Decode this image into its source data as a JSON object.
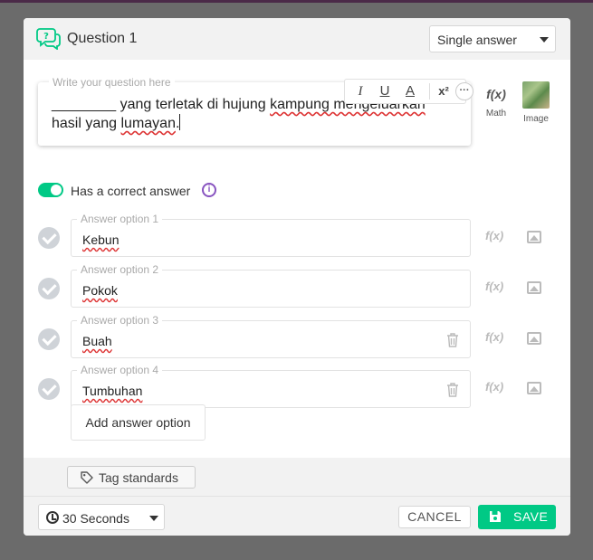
{
  "header": {
    "title": "Question 1",
    "question_type": "Single answer"
  },
  "question": {
    "placeholder_label": "Write your question here",
    "text_blank": "________",
    "text_1": " yang terletak di hujung ",
    "text_2": "kampung mengeluarkan",
    "text_3": "hasil yang ",
    "text_4": "lumayan",
    "text_5": "."
  },
  "toolbar": {
    "italic": "I",
    "underline": "U",
    "color": "A",
    "superscript": "x²",
    "more": "···"
  },
  "side_tools": {
    "math_glyph": "f(x)",
    "math_label": "Math",
    "image_label": "Image"
  },
  "correct_answer": {
    "label": "Has a correct answer",
    "enabled": true,
    "info": "i"
  },
  "answers": [
    {
      "label": "Answer option 1",
      "text": "Kebun"
    },
    {
      "label": "Answer option 2",
      "text": "Pokok"
    },
    {
      "label": "Answer option 3",
      "text": "Buah"
    },
    {
      "label": "Answer option 4",
      "text": "Tumbuhan"
    }
  ],
  "answer_tools": {
    "fx": "f(x)"
  },
  "add_answer_label": "Add answer option",
  "tag_standards_label": "Tag standards",
  "footer": {
    "time": "30 Seconds",
    "cancel": "CANCEL",
    "save": "SAVE"
  },
  "colors": {
    "accent_green": "#00c985",
    "info_purple": "#8854c0"
  }
}
